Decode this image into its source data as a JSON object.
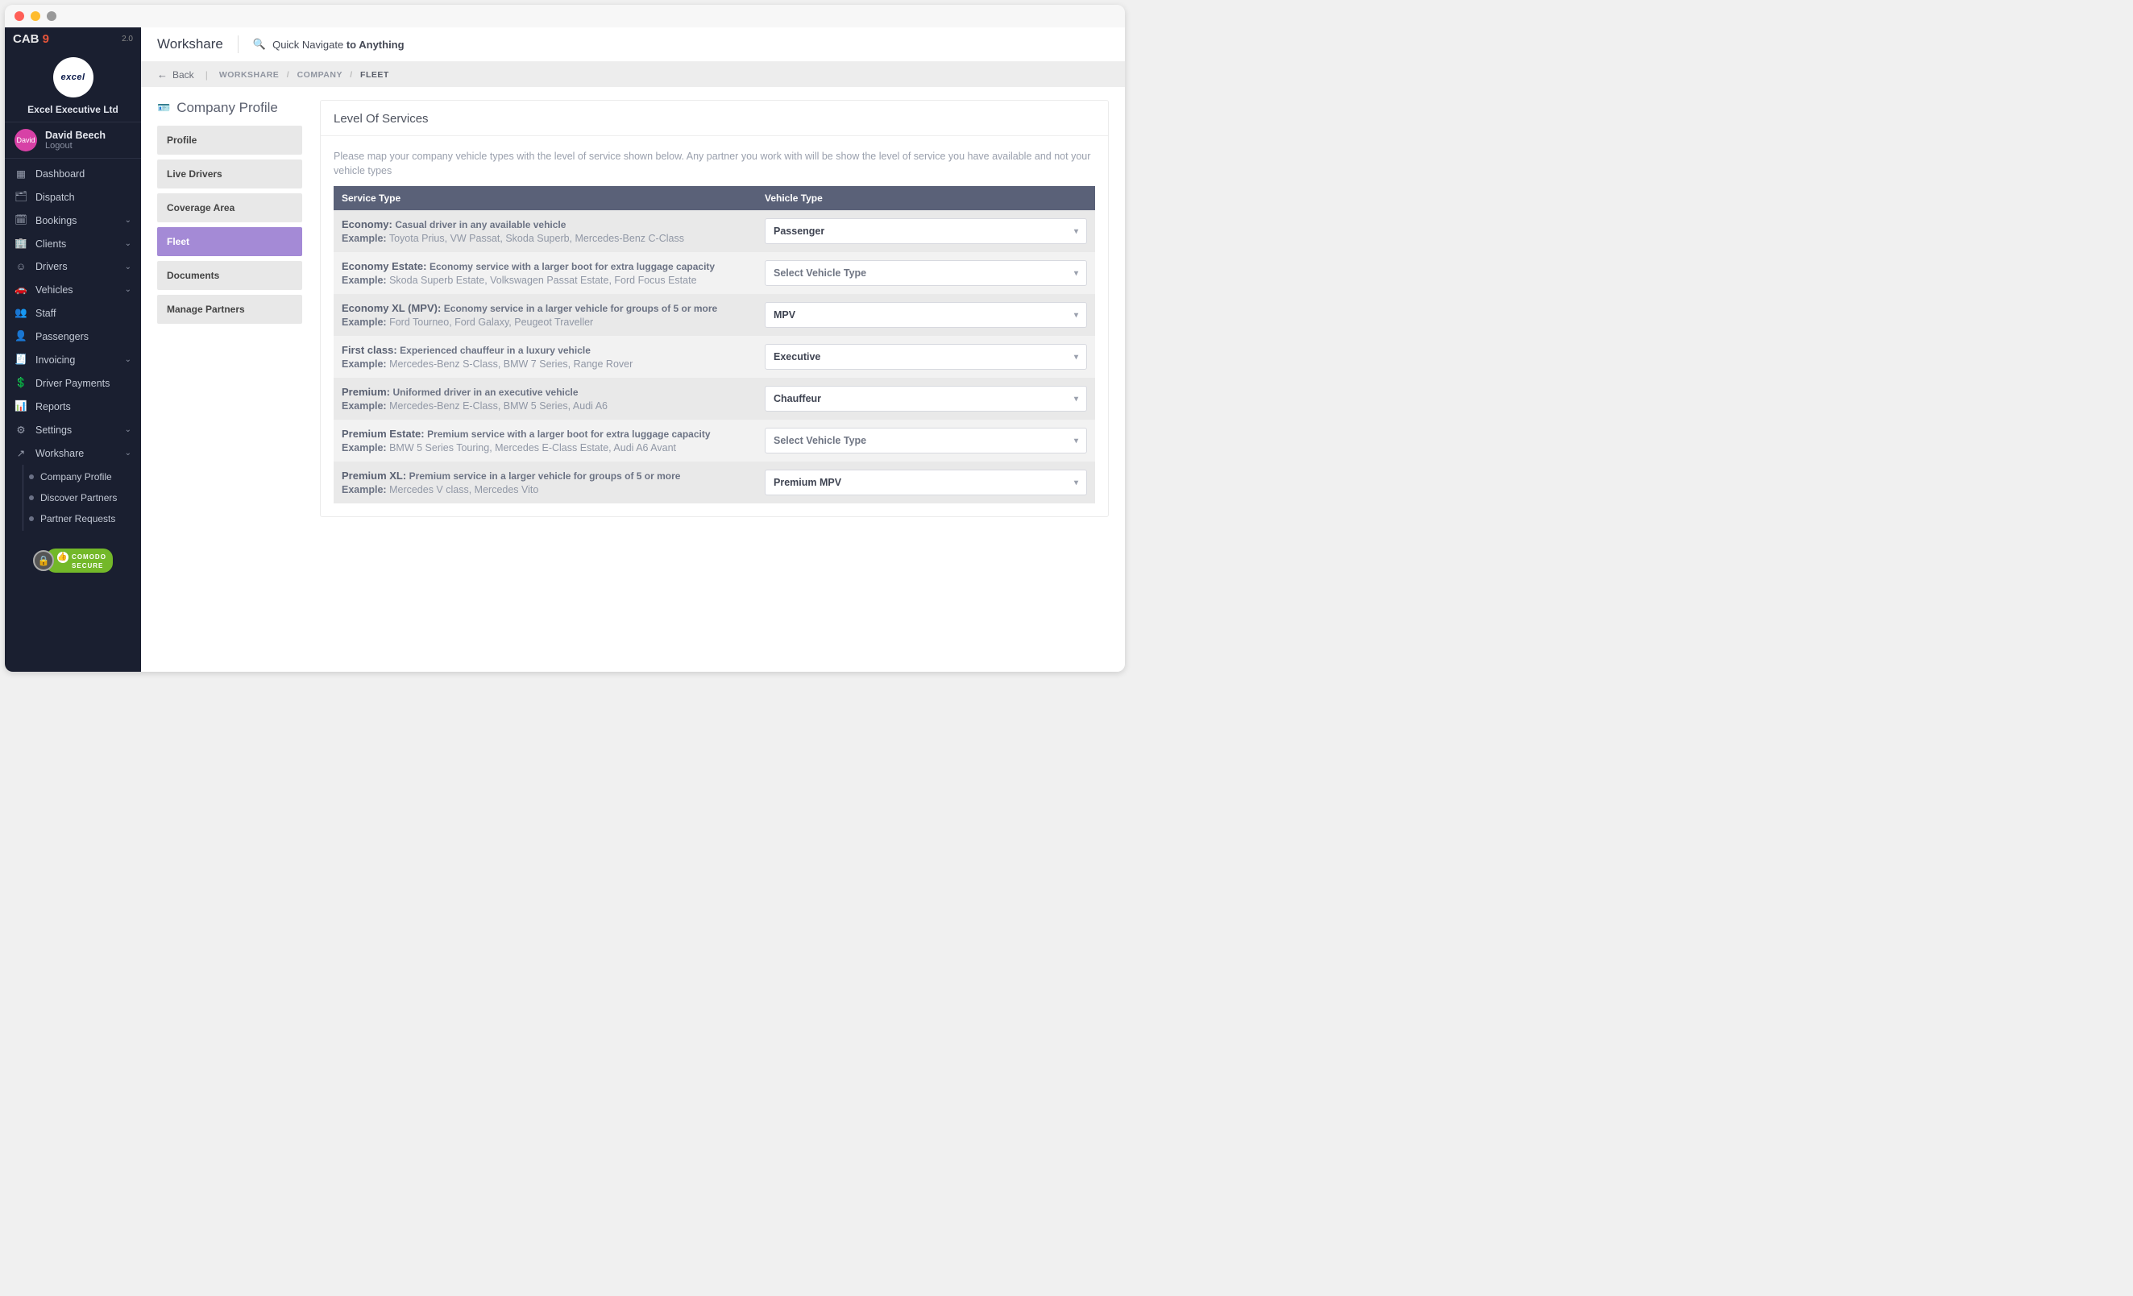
{
  "brand": {
    "part1": "CAB",
    "part2": " 9",
    "version": "2.0"
  },
  "company": {
    "name": "Excel Executive Ltd",
    "logo_text": "excel"
  },
  "user": {
    "name": "David Beech",
    "avatar_text": "David",
    "logout_label": "Logout"
  },
  "sidebar": {
    "items": [
      {
        "label": "Dashboard",
        "icon": "▦",
        "chev": false
      },
      {
        "label": "Dispatch",
        "icon": "🗂",
        "chev": false
      },
      {
        "label": "Bookings",
        "icon": "🗓",
        "chev": true
      },
      {
        "label": "Clients",
        "icon": "🏢",
        "chev": true
      },
      {
        "label": "Drivers",
        "icon": "☺",
        "chev": true
      },
      {
        "label": "Vehicles",
        "icon": "🚗",
        "chev": true
      },
      {
        "label": "Staff",
        "icon": "👥",
        "chev": false
      },
      {
        "label": "Passengers",
        "icon": "👤",
        "chev": false
      },
      {
        "label": "Invoicing",
        "icon": "🧾",
        "chev": true
      },
      {
        "label": "Driver Payments",
        "icon": "💲",
        "chev": false
      },
      {
        "label": "Reports",
        "icon": "📊",
        "chev": false
      },
      {
        "label": "Settings",
        "icon": "⚙",
        "chev": true
      },
      {
        "label": "Workshare",
        "icon": "↗",
        "chev": true
      }
    ],
    "sub_workshare": [
      {
        "label": "Company Profile"
      },
      {
        "label": "Discover Partners"
      },
      {
        "label": "Partner Requests"
      }
    ],
    "secure_top": "COMODO",
    "secure_bottom": "SECURE"
  },
  "header": {
    "title": "Workshare",
    "quick_nav_pre": "Quick Navigate ",
    "quick_nav_bold": "to Anything"
  },
  "breadcrumb": {
    "back": "Back",
    "parts": [
      "WORKSHARE",
      "COMPANY",
      "FLEET"
    ]
  },
  "page": {
    "title": "Company Profile",
    "menu": [
      "Profile",
      "Live Drivers",
      "Coverage Area",
      "Fleet",
      "Documents",
      "Manage Partners"
    ],
    "active_menu": 3
  },
  "panel": {
    "title": "Level Of Services",
    "help": "Please map your company vehicle types with the level of service shown below. Any partner you work with will be show the level of service you have available and not your vehicle types",
    "columns": {
      "service": "Service Type",
      "vehicle": "Vehicle Type"
    },
    "placeholder": "Select Vehicle Type",
    "example_label": "Example:",
    "rows": [
      {
        "name": "Economy:",
        "desc": "Casual driver in any available vehicle",
        "example": "Toyota Prius, VW Passat, Skoda Superb, Mercedes-Benz C-Class",
        "value": "Passenger"
      },
      {
        "name": "Economy Estate:",
        "desc": "Economy service with a larger boot for extra luggage capacity",
        "example": "Skoda Superb Estate, Volkswagen Passat Estate, Ford Focus Estate",
        "value": ""
      },
      {
        "name": "Economy XL (MPV):",
        "desc": "Economy service in a larger vehicle for groups of 5 or more",
        "example": "Ford Tourneo, Ford Galaxy, Peugeot Traveller",
        "value": "MPV"
      },
      {
        "name": "First class:",
        "desc": "Experienced chauffeur in a luxury vehicle",
        "example": "Mercedes-Benz S-Class, BMW 7 Series, Range Rover",
        "value": "Executive"
      },
      {
        "name": "Premium:",
        "desc": "Uniformed driver in an executive vehicle",
        "example": "Mercedes-Benz E-Class, BMW 5 Series, Audi A6",
        "value": "Chauffeur"
      },
      {
        "name": "Premium Estate:",
        "desc": "Premium service with a larger boot for extra luggage capacity",
        "example": "BMW 5 Series Touring, Mercedes E-Class Estate, Audi A6 Avant",
        "value": ""
      },
      {
        "name": "Premium XL:",
        "desc": "Premium service in a larger vehicle for groups of 5 or more",
        "example": "Mercedes V class, Mercedes Vito",
        "value": "Premium MPV"
      }
    ]
  }
}
